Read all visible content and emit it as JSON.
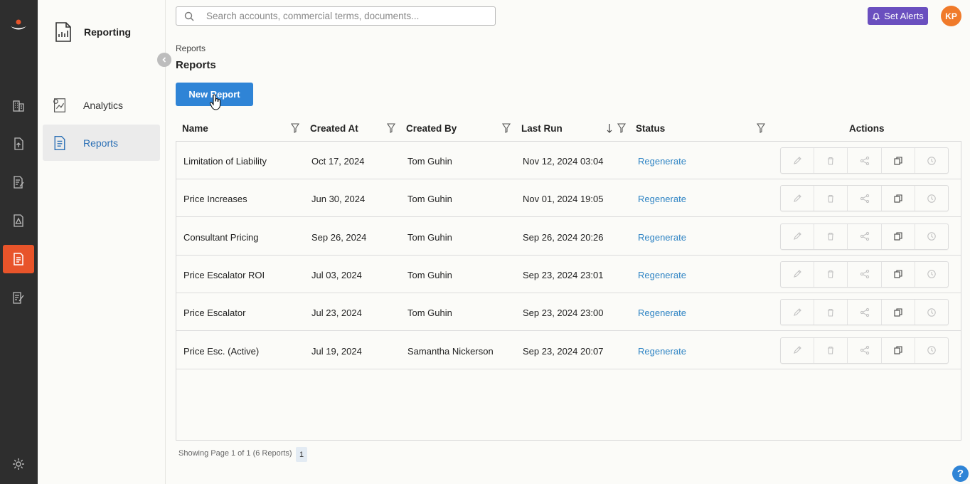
{
  "search": {
    "placeholder": "Search accounts, commercial terms, documents...",
    "value": ""
  },
  "header": {
    "alerts_label": "Set Alerts",
    "avatar_initials": "KP"
  },
  "sidebar": {
    "title": "Reporting",
    "items": [
      {
        "label": "Analytics",
        "icon": "analytics-icon"
      },
      {
        "label": "Reports",
        "icon": "reports-icon",
        "active": true
      }
    ]
  },
  "rail": {
    "items": [
      "buildings-icon",
      "upload-icon",
      "document-edit-icon",
      "document-alert-icon",
      "reports-icon",
      "signature-icon"
    ],
    "active": "reports-icon",
    "settings": "settings-icon"
  },
  "main": {
    "breadcrumb": "Reports",
    "title": "Reports",
    "new_button": "New Report"
  },
  "table": {
    "columns": [
      "Name",
      "Created At",
      "Created By",
      "Last Run",
      "Status",
      "Actions"
    ],
    "rows": [
      {
        "name": "Limitation of Liability",
        "created_at": "Oct 17, 2024",
        "created_by": "Tom Guhin",
        "last_run": "Nov 12, 2024 03:04",
        "status": "Regenerate"
      },
      {
        "name": "Price Increases",
        "created_at": "Jun 30, 2024",
        "created_by": "Tom Guhin",
        "last_run": "Nov 01, 2024 19:05",
        "status": "Regenerate"
      },
      {
        "name": "Consultant Pricing",
        "created_at": "Sep 26, 2024",
        "created_by": "Tom Guhin",
        "last_run": "Sep 26, 2024 20:26",
        "status": "Regenerate"
      },
      {
        "name": "Price Escalator ROI",
        "created_at": "Jul 03, 2024",
        "created_by": "Tom Guhin",
        "last_run": "Sep 23, 2024 23:01",
        "status": "Regenerate"
      },
      {
        "name": "Price Escalator",
        "created_at": "Jul 23, 2024",
        "created_by": "Tom Guhin",
        "last_run": "Sep 23, 2024 23:00",
        "status": "Regenerate"
      },
      {
        "name": "Price Esc. (Active)",
        "created_at": "Jul 19, 2024",
        "created_by": "Samantha Nickerson",
        "last_run": "Sep 23, 2024 20:07",
        "status": "Regenerate"
      }
    ],
    "row_actions": [
      "edit-icon",
      "delete-icon",
      "share-icon",
      "copy-icon",
      "history-icon"
    ]
  },
  "footer": {
    "summary": "Showing Page 1 of 1 (6 Reports)",
    "page": "1"
  },
  "help_label": "?",
  "colors": {
    "accent": "#2f84d6",
    "rail_active": "#e8542a",
    "alerts": "#6a4fbf",
    "avatar": "#f07a2a",
    "link": "#2f84c4"
  }
}
